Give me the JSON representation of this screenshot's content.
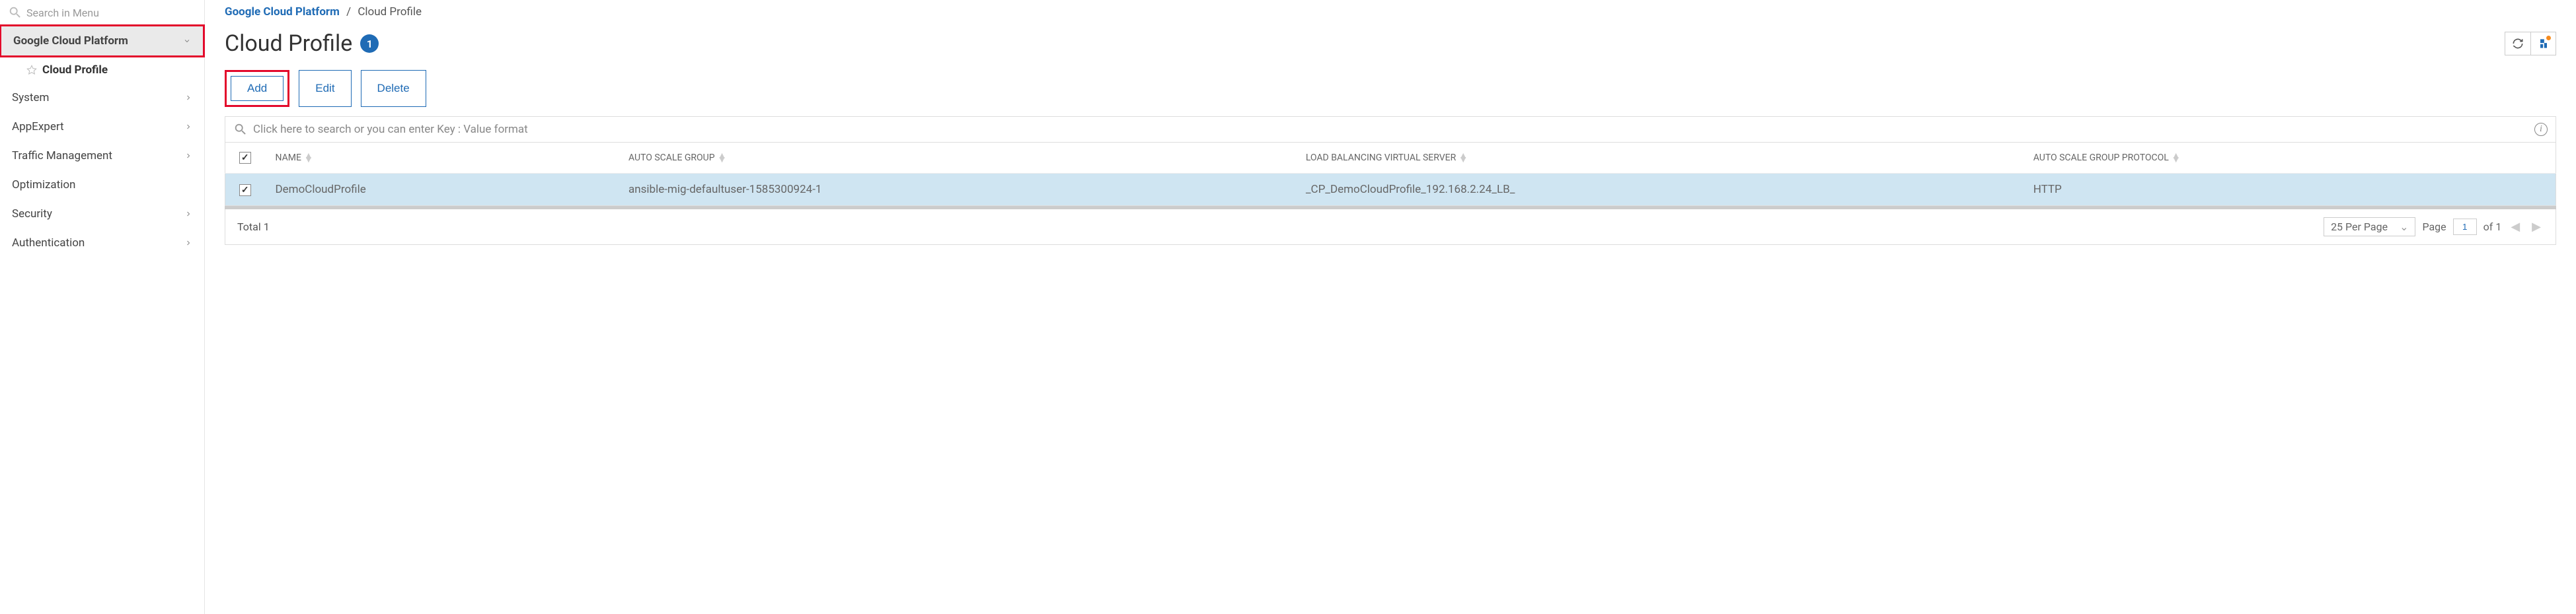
{
  "sidebar": {
    "search_placeholder": "Search in Menu",
    "expanded": {
      "label": "Google Cloud Platform",
      "sub": "Cloud Profile"
    },
    "items": [
      {
        "label": "System"
      },
      {
        "label": "AppExpert"
      },
      {
        "label": "Traffic Management"
      },
      {
        "label": "Optimization"
      },
      {
        "label": "Security"
      },
      {
        "label": "Authentication"
      }
    ]
  },
  "breadcrumb": {
    "root": "Google Cloud Platform",
    "current": "Cloud Profile"
  },
  "header": {
    "title": "Cloud Profile",
    "count": "1"
  },
  "toolbar": {
    "add": "Add",
    "edit": "Edit",
    "delete": "Delete"
  },
  "search": {
    "placeholder": "Click here to search or you can enter Key : Value format"
  },
  "table": {
    "columns": {
      "name": "NAME",
      "auto_scale_group": "AUTO SCALE GROUP",
      "lb_vserver": "LOAD BALANCING VIRTUAL SERVER",
      "protocol": "AUTO SCALE GROUP PROTOCOL"
    },
    "rows": [
      {
        "name": "DemoCloudProfile",
        "auto_scale_group": "ansible-mig-defaultuser-1585300924-1",
        "lb_vserver": "_CP_DemoCloudProfile_192.168.2.24_LB_",
        "protocol": "HTTP"
      }
    ]
  },
  "footer": {
    "total_label": "Total",
    "total_value": "1",
    "per_page": "25 Per Page",
    "page_label": "Page",
    "page_value": "1",
    "page_of": "of 1"
  }
}
